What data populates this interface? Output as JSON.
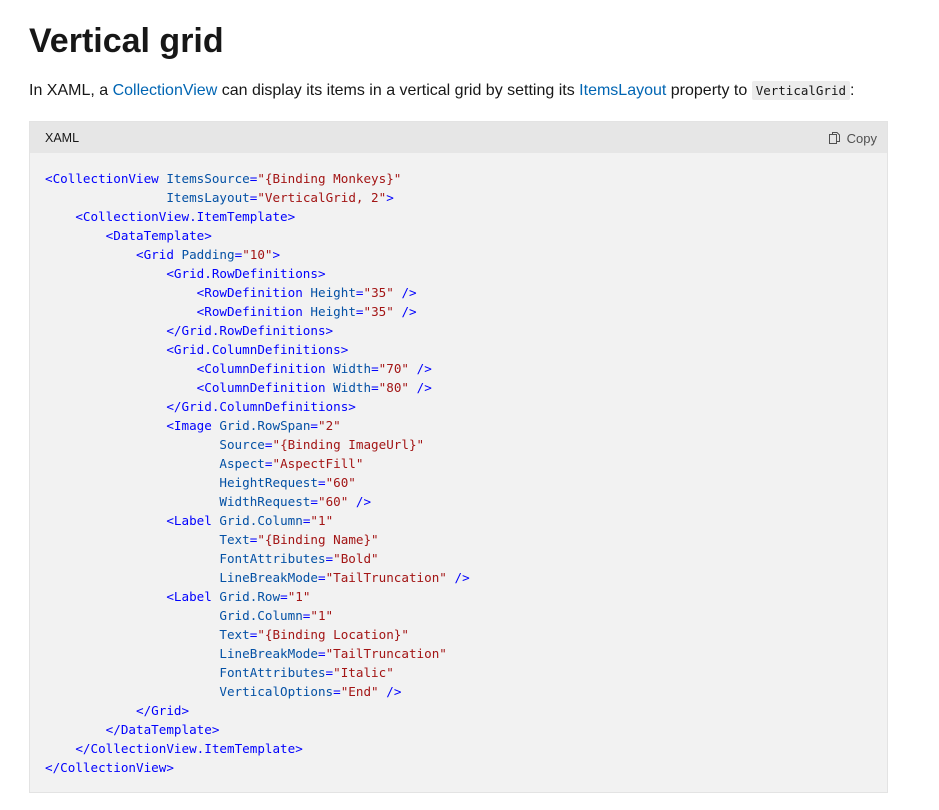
{
  "page": {
    "title": "Vertical grid",
    "intro": {
      "text_1": "In XAML, a ",
      "link_collectionview": "CollectionView",
      "text_2": " can display its items in a vertical grid by setting its ",
      "link_itemslayout": "ItemsLayout",
      "text_3": " property to ",
      "code_value": "VerticalGrid",
      "text_4": ":"
    }
  },
  "code_block": {
    "language": "XAML",
    "copy_label": "Copy",
    "icon": "copy-icon",
    "lines": [
      [
        [
          "tag",
          "<CollectionView"
        ],
        [
          "plain",
          " "
        ],
        [
          "attr",
          "ItemsSource"
        ],
        [
          "tag",
          "="
        ],
        [
          "val",
          "\"{Binding Monkeys}\""
        ]
      ],
      [
        [
          "plain",
          "                "
        ],
        [
          "attr",
          "ItemsLayout"
        ],
        [
          "tag",
          "="
        ],
        [
          "val",
          "\"VerticalGrid, 2\""
        ],
        [
          "tag",
          ">"
        ]
      ],
      [
        [
          "plain",
          "    "
        ],
        [
          "tag",
          "<CollectionView.ItemTemplate>"
        ]
      ],
      [
        [
          "plain",
          "        "
        ],
        [
          "tag",
          "<DataTemplate>"
        ]
      ],
      [
        [
          "plain",
          "            "
        ],
        [
          "tag",
          "<Grid"
        ],
        [
          "plain",
          " "
        ],
        [
          "attr",
          "Padding"
        ],
        [
          "tag",
          "="
        ],
        [
          "val",
          "\"10\""
        ],
        [
          "tag",
          ">"
        ]
      ],
      [
        [
          "plain",
          "                "
        ],
        [
          "tag",
          "<Grid.RowDefinitions>"
        ]
      ],
      [
        [
          "plain",
          "                    "
        ],
        [
          "tag",
          "<RowDefinition"
        ],
        [
          "plain",
          " "
        ],
        [
          "attr",
          "Height"
        ],
        [
          "tag",
          "="
        ],
        [
          "val",
          "\"35\""
        ],
        [
          "plain",
          " "
        ],
        [
          "tag",
          "/>"
        ]
      ],
      [
        [
          "plain",
          "                    "
        ],
        [
          "tag",
          "<RowDefinition"
        ],
        [
          "plain",
          " "
        ],
        [
          "attr",
          "Height"
        ],
        [
          "tag",
          "="
        ],
        [
          "val",
          "\"35\""
        ],
        [
          "plain",
          " "
        ],
        [
          "tag",
          "/>"
        ]
      ],
      [
        [
          "plain",
          "                "
        ],
        [
          "tag",
          "</Grid.RowDefinitions>"
        ]
      ],
      [
        [
          "plain",
          "                "
        ],
        [
          "tag",
          "<Grid.ColumnDefinitions>"
        ]
      ],
      [
        [
          "plain",
          "                    "
        ],
        [
          "tag",
          "<ColumnDefinition"
        ],
        [
          "plain",
          " "
        ],
        [
          "attr",
          "Width"
        ],
        [
          "tag",
          "="
        ],
        [
          "val",
          "\"70\""
        ],
        [
          "plain",
          " "
        ],
        [
          "tag",
          "/>"
        ]
      ],
      [
        [
          "plain",
          "                    "
        ],
        [
          "tag",
          "<ColumnDefinition"
        ],
        [
          "plain",
          " "
        ],
        [
          "attr",
          "Width"
        ],
        [
          "tag",
          "="
        ],
        [
          "val",
          "\"80\""
        ],
        [
          "plain",
          " "
        ],
        [
          "tag",
          "/>"
        ]
      ],
      [
        [
          "plain",
          "                "
        ],
        [
          "tag",
          "</Grid.ColumnDefinitions>"
        ]
      ],
      [
        [
          "plain",
          "                "
        ],
        [
          "tag",
          "<Image"
        ],
        [
          "plain",
          " "
        ],
        [
          "attr",
          "Grid.RowSpan"
        ],
        [
          "tag",
          "="
        ],
        [
          "val",
          "\"2\""
        ]
      ],
      [
        [
          "plain",
          "                       "
        ],
        [
          "attr",
          "Source"
        ],
        [
          "tag",
          "="
        ],
        [
          "val",
          "\"{Binding ImageUrl}\""
        ]
      ],
      [
        [
          "plain",
          "                       "
        ],
        [
          "attr",
          "Aspect"
        ],
        [
          "tag",
          "="
        ],
        [
          "val",
          "\"AspectFill\""
        ]
      ],
      [
        [
          "plain",
          "                       "
        ],
        [
          "attr",
          "HeightRequest"
        ],
        [
          "tag",
          "="
        ],
        [
          "val",
          "\"60\""
        ]
      ],
      [
        [
          "plain",
          "                       "
        ],
        [
          "attr",
          "WidthRequest"
        ],
        [
          "tag",
          "="
        ],
        [
          "val",
          "\"60\""
        ],
        [
          "plain",
          " "
        ],
        [
          "tag",
          "/>"
        ]
      ],
      [
        [
          "plain",
          "                "
        ],
        [
          "tag",
          "<Label"
        ],
        [
          "plain",
          " "
        ],
        [
          "attr",
          "Grid.Column"
        ],
        [
          "tag",
          "="
        ],
        [
          "val",
          "\"1\""
        ]
      ],
      [
        [
          "plain",
          "                       "
        ],
        [
          "attr",
          "Text"
        ],
        [
          "tag",
          "="
        ],
        [
          "val",
          "\"{Binding Name}\""
        ]
      ],
      [
        [
          "plain",
          "                       "
        ],
        [
          "attr",
          "FontAttributes"
        ],
        [
          "tag",
          "="
        ],
        [
          "val",
          "\"Bold\""
        ]
      ],
      [
        [
          "plain",
          "                       "
        ],
        [
          "attr",
          "LineBreakMode"
        ],
        [
          "tag",
          "="
        ],
        [
          "val",
          "\"TailTruncation\""
        ],
        [
          "plain",
          " "
        ],
        [
          "tag",
          "/>"
        ]
      ],
      [
        [
          "plain",
          "                "
        ],
        [
          "tag",
          "<Label"
        ],
        [
          "plain",
          " "
        ],
        [
          "attr",
          "Grid.Row"
        ],
        [
          "tag",
          "="
        ],
        [
          "val",
          "\"1\""
        ]
      ],
      [
        [
          "plain",
          "                       "
        ],
        [
          "attr",
          "Grid.Column"
        ],
        [
          "tag",
          "="
        ],
        [
          "val",
          "\"1\""
        ]
      ],
      [
        [
          "plain",
          "                       "
        ],
        [
          "attr",
          "Text"
        ],
        [
          "tag",
          "="
        ],
        [
          "val",
          "\"{Binding Location}\""
        ]
      ],
      [
        [
          "plain",
          "                       "
        ],
        [
          "attr",
          "LineBreakMode"
        ],
        [
          "tag",
          "="
        ],
        [
          "val",
          "\"TailTruncation\""
        ]
      ],
      [
        [
          "plain",
          "                       "
        ],
        [
          "attr",
          "FontAttributes"
        ],
        [
          "tag",
          "="
        ],
        [
          "val",
          "\"Italic\""
        ]
      ],
      [
        [
          "plain",
          "                       "
        ],
        [
          "attr",
          "VerticalOptions"
        ],
        [
          "tag",
          "="
        ],
        [
          "val",
          "\"End\""
        ],
        [
          "plain",
          " "
        ],
        [
          "tag",
          "/>"
        ]
      ],
      [
        [
          "plain",
          "            "
        ],
        [
          "tag",
          "</Grid>"
        ]
      ],
      [
        [
          "plain",
          "        "
        ],
        [
          "tag",
          "</DataTemplate>"
        ]
      ],
      [
        [
          "plain",
          "    "
        ],
        [
          "tag",
          "</CollectionView.ItemTemplate>"
        ]
      ],
      [
        [
          "tag",
          "</CollectionView>"
        ]
      ]
    ]
  },
  "colors": {
    "link": "#0065b3",
    "xml_tag": "#0101fd",
    "xml_attribute": "#0451a5",
    "xml_value": "#a31515"
  }
}
